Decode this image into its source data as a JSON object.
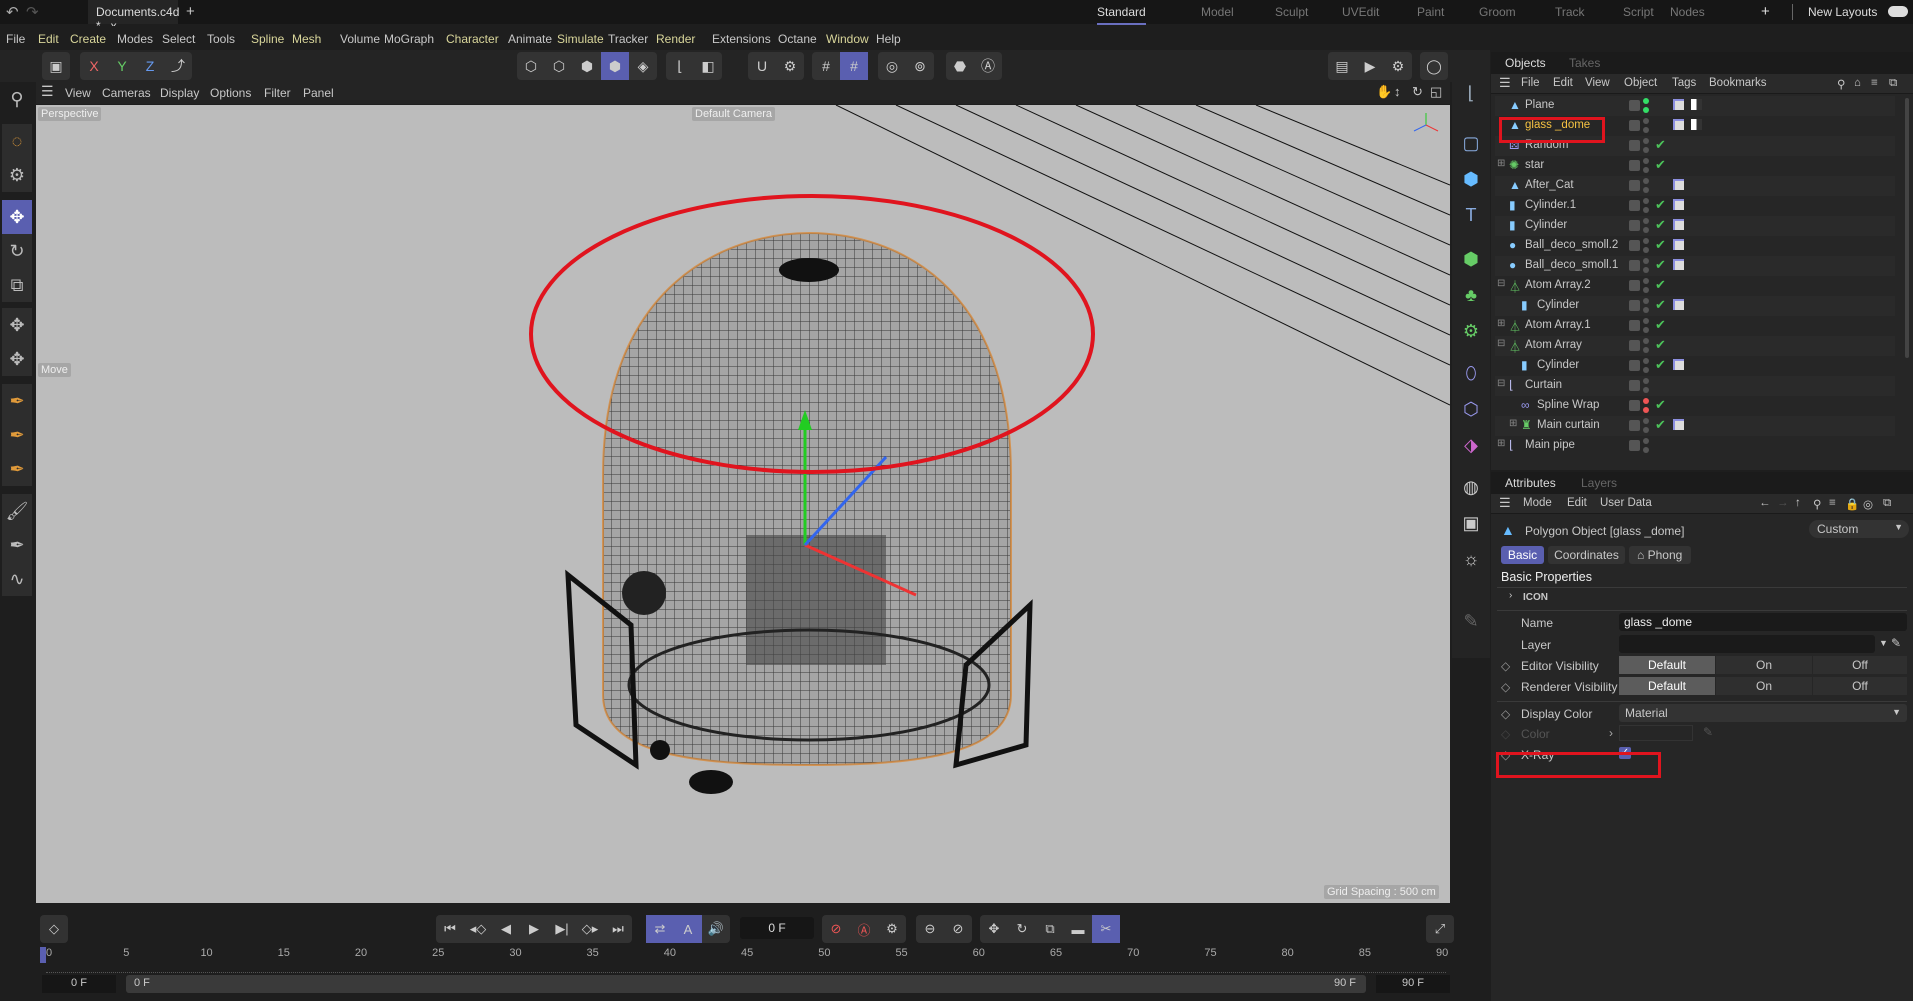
{
  "titlebar": {
    "document_tab": "Documents.c4d *",
    "close": "x",
    "new_tab": "+",
    "undo_icon": "undo-icon",
    "redo_icon": "redo-icon"
  },
  "layouts": {
    "tabs": [
      "Standard",
      "Model",
      "Sculpt",
      "UVEdit",
      "Paint",
      "Groom",
      "Track",
      "Script",
      "Nodes"
    ],
    "active": "Standard",
    "add": "+",
    "new_layouts": "New Layouts"
  },
  "menu": [
    "File",
    "Edit",
    "Create",
    "Modes",
    "Select",
    "Tools",
    "Spline",
    "Mesh",
    "Volume",
    "MoGraph",
    "Character",
    "Animate",
    "Simulate",
    "Tracker",
    "Render",
    "Extensions",
    "Octane",
    "Window",
    "Help"
  ],
  "toolbar": {
    "axes": [
      "X",
      "Y",
      "Z"
    ]
  },
  "viewport": {
    "menu": [
      "View",
      "Cameras",
      "Display",
      "Options",
      "Filter",
      "Panel"
    ],
    "view_name": "Perspective",
    "camera": "Default Camera",
    "tool_hint": "Move",
    "grid_spacing": "Grid Spacing : 500 cm",
    "background": "#bcbcbc",
    "highlight_color": "#e0141e"
  },
  "objects_panel": {
    "tabs": [
      "Objects",
      "Takes"
    ],
    "menu": [
      "File",
      "Edit",
      "View",
      "Object",
      "Tags",
      "Bookmarks"
    ],
    "items": [
      {
        "name": "Plane",
        "icon": "polygon-icon",
        "depth": 0,
        "expander": "",
        "check": false,
        "dots": "green",
        "tags": 2
      },
      {
        "name": "glass _dome",
        "icon": "polygon-icon",
        "depth": 0,
        "expander": "",
        "check": false,
        "dots": "gray",
        "tags": 2,
        "selected": true
      },
      {
        "name": "Random",
        "icon": "random-effector-icon",
        "depth": 0,
        "expander": "",
        "check": true,
        "dots": "gray",
        "tags": 0
      },
      {
        "name": "star",
        "icon": "star-icon",
        "depth": 0,
        "expander": "+",
        "check": true,
        "dots": "gray",
        "tags": 0
      },
      {
        "name": "After_Cat",
        "icon": "polygon-icon",
        "depth": 0,
        "expander": "",
        "check": false,
        "dots": "gray",
        "tags": 1
      },
      {
        "name": "Cylinder.1",
        "icon": "cylinder-icon",
        "depth": 0,
        "expander": "",
        "check": true,
        "dots": "gray",
        "tags": 1
      },
      {
        "name": "Cylinder",
        "icon": "cylinder-icon",
        "depth": 0,
        "expander": "",
        "check": true,
        "dots": "gray",
        "tags": 1
      },
      {
        "name": "Ball_deco_smoll.2",
        "icon": "sphere-icon",
        "depth": 0,
        "expander": "",
        "check": true,
        "dots": "gray",
        "tags": 1
      },
      {
        "name": "Ball_deco_smoll.1",
        "icon": "sphere-icon",
        "depth": 0,
        "expander": "",
        "check": true,
        "dots": "gray",
        "tags": 1
      },
      {
        "name": "Atom Array.2",
        "icon": "atom-array-icon",
        "depth": 0,
        "expander": "-",
        "check": true,
        "dots": "gray",
        "tags": 0
      },
      {
        "name": "Cylinder",
        "icon": "cylinder-icon",
        "depth": 1,
        "expander": "",
        "check": true,
        "dots": "gray",
        "tags": 1
      },
      {
        "name": "Atom Array.1",
        "icon": "atom-array-icon",
        "depth": 0,
        "expander": "+",
        "check": true,
        "dots": "gray",
        "tags": 0
      },
      {
        "name": "Atom Array",
        "icon": "atom-array-icon",
        "depth": 0,
        "expander": "-",
        "check": true,
        "dots": "gray",
        "tags": 0
      },
      {
        "name": "Cylinder",
        "icon": "cylinder-icon",
        "depth": 1,
        "expander": "",
        "check": true,
        "dots": "gray",
        "tags": 1
      },
      {
        "name": "Curtain",
        "icon": "sweep-icon",
        "depth": 0,
        "expander": "-",
        "check": false,
        "dots": "gray",
        "tags": 0
      },
      {
        "name": "Spline Wrap",
        "icon": "spline-wrap-icon",
        "depth": 1,
        "expander": "",
        "check": true,
        "dots": "red",
        "tags": 0
      },
      {
        "name": "Main curtain",
        "icon": "cloth-icon",
        "depth": 1,
        "expander": "+",
        "check": true,
        "dots": "gray",
        "tags": 1
      },
      {
        "name": "Main pipe",
        "icon": "sweep-icon",
        "depth": 0,
        "expander": "+",
        "check": false,
        "dots": "gray",
        "tags": 0
      }
    ]
  },
  "attributes": {
    "tabs": [
      "Attributes",
      "Layers"
    ],
    "menu": [
      "Mode",
      "Edit",
      "User Data"
    ],
    "object_title": "Polygon Object [glass _dome]",
    "preset": "Custom",
    "subtabs": [
      "Basic",
      "Coordinates",
      "Phong"
    ],
    "active_subtab": "Basic",
    "section": "Basic Properties",
    "icon_group": "ICON",
    "name_label": "Name",
    "name_value": "glass _dome",
    "layer_label": "Layer",
    "layer_value": "",
    "editor_visibility": {
      "label": "Editor Visibility",
      "options": [
        "Default",
        "On",
        "Off"
      ],
      "selected": "Default"
    },
    "renderer_visibility": {
      "label": "Renderer Visibility",
      "options": [
        "Default",
        "On",
        "Off"
      ],
      "selected": "Default"
    },
    "display_color": {
      "label": "Display Color",
      "value": "Material"
    },
    "color_label": "Color",
    "xray": {
      "label": "X-Ray",
      "checked": true
    }
  },
  "timeline": {
    "current_frame": "0 F",
    "ruler": [
      "0",
      "5",
      "10",
      "15",
      "20",
      "25",
      "30",
      "35",
      "40",
      "45",
      "50",
      "55",
      "60",
      "65",
      "70",
      "75",
      "80",
      "85",
      "90"
    ],
    "start": "0 F",
    "range_start": "0 F",
    "range_end": "90 F",
    "end": "90 F"
  }
}
